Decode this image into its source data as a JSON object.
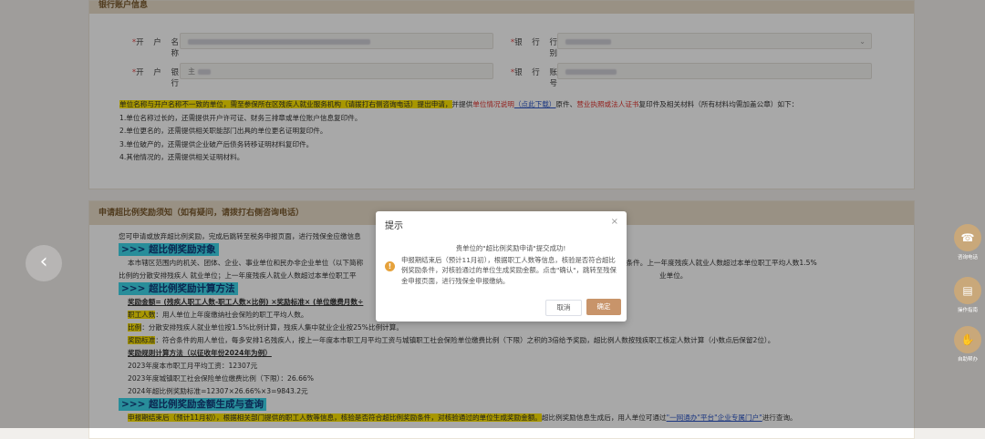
{
  "bank_section": {
    "title": "银行账户信息",
    "account_name_label": "开 户 名 称",
    "bank_category_label": "银 行 行 别",
    "bank_name_label": "开 户 银 行",
    "account_no_label": "银 行 账 号",
    "bank_name_value": "主",
    "required_mark": "*"
  },
  "notes": {
    "line1_hl": "单位名称与开户名称不一致的单位，需至参保所在区残疾人就业服务机构（请拨打右侧咨询电话）提出申请，",
    "line1_a": "并提供",
    "line1_red1": "单位情况说明",
    "line1_link": "（点此下载）",
    "line1_b": "原件、",
    "line1_red2": "营业执照或法人证书",
    "line1_c": "复印件及相关材料（所有材料均需加盖公章）如下：",
    "items": [
      "1.单位名称过长的，还需提供开户许可证、财务三排章或单位账户信息复印件。",
      "2.单位更名的，还需提供相关职能部门出具的单位更名证明复印件。",
      "3.单位破产的，还需提供企业破产后债务转移证明材料复印件。",
      "4.其他情况的，还需提供相关证明材料。"
    ]
  },
  "reward_section": {
    "title": "申请超比例奖励须知（如有疑问，请拨打右侧咨询电话）",
    "intro": "您可申请或放弃超比例奖励，完成后跳转至税务申报页面，进行残保金应缴信息",
    "sec1": ">>> 超比例奖励对象",
    "sec1_body_a": "本市辖区范围内的机关、团体、企业、事业单位和民办非企业单位（以下简称",
    "sec1_body_b": "超比例安排残疾人就业条件。上一年度残疾人就业人数超过本单位职工平均人数1.5%",
    "sec1_body_c": "比例的分散安排残疾人 就业单位；上一年度残疾人就业人数超过本单位职工平",
    "sec1_body_d": "业单位。",
    "sec2": ">>> 超比例奖励计算方法",
    "formula": "奖励金额= (残疾人职工人数-职工人数×比例) ×奖励标准× (单位缴费月数÷",
    "k1": "职工人数",
    "v1": "：用人单位上年度缴纳社会保险的职工平均人数。",
    "k2": "比例",
    "v2": "：分散安排残疾人就业单位按1.5%比例计算，残疾人集中就业企业按25%比例计算。",
    "k3": "奖励标准",
    "v3": "：符合条件的用人单位，每多安排1名残疾人，按上一年度本市职工月平均工资与城镇职工社会保险单位缴费比例（下限）之积的3倍给予奖励，超比例人数按残疾职工核定人数计算（小数点后保留2位）。",
    "example_title": "奖励规则计算方法（以征收年份2024年为例）",
    "ex1": "2023年度本市职工月平均工资：12307元",
    "ex2": "2023年度城镇职工社会保险单位缴费比例（下限）：26.66%",
    "ex3": "2024年超比例奖励标准=12307×26.66%×3=9843.2元",
    "sec3": ">>> 超比例奖励金额生成与查询",
    "last_hl": "申报期结束后（预计11月初），根据相关部门提供的职工人数等信息，核验是否符合超比例奖励条件，对核验通过的单位生成奖励金额。",
    "last_a": "超比例奖励信息生成后，用人单位可通过",
    "last_link": "\"一网通办\"平台\"企业专属门户\"",
    "last_b": "进行查询。"
  },
  "dialog": {
    "title": "提示",
    "close": "×",
    "msg1": "贵单位的\"超比例奖励申请\"提交成功!",
    "msg2": "申报期结束后（预计11月初），根据职工人数等信息，核验是否符合超比例奖励条件，对核验通过的单位生成奖励金额。点击\"确认\"，跳转至残保金申报页面，进行残保金申报缴纳。",
    "cancel": "取消",
    "confirm": "确定"
  },
  "side": {
    "consult": "咨询电话",
    "manual": "操作指南",
    "help": "自助帮办"
  },
  "colors": {
    "accent": "#c8946a",
    "highlight": "#ffe600",
    "section_title_bg": "#3ed6ea"
  }
}
